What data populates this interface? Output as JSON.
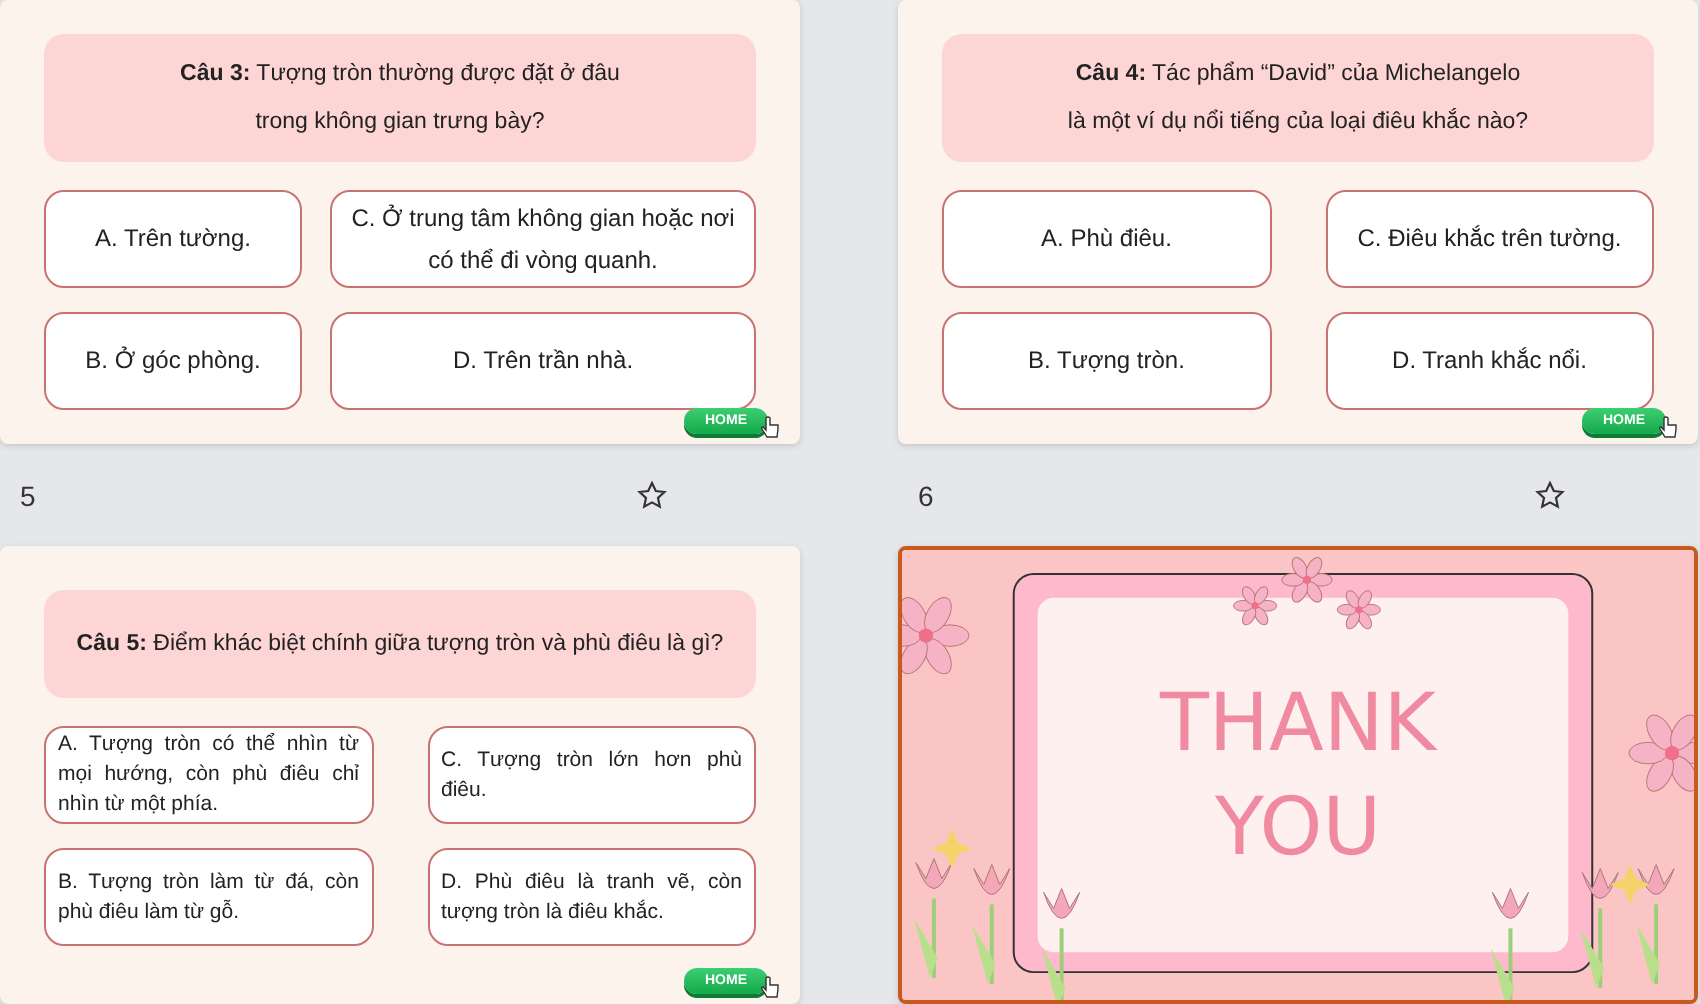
{
  "slides": [
    {
      "kind": "quiz",
      "selected": false,
      "number": "5",
      "question_lines": [
        "**Câu 3:** Tượng tròn thường được đặt ở đâu",
        "trong không gian trưng bày?"
      ],
      "options": [
        "A. Trên tường.",
        "B. Ở góc phòng.",
        "C. Ở trung tâm không gian hoặc nơi có thể đi vòng quanh.",
        "D. Trên trần nhà."
      ],
      "home": "HOME"
    },
    {
      "kind": "quiz",
      "selected": false,
      "number": "6",
      "question_lines": [
        "**Câu 4:** Tác phẩm “David” của Michelangelo",
        "là một ví dụ nổi tiếng của loại điêu khắc nào?"
      ],
      "options": [
        "A. Phù điêu.",
        "B. Tượng tròn.",
        "C. Điêu khắc trên tường.",
        "D. Tranh khắc nổi."
      ],
      "home": "HOME"
    },
    {
      "kind": "quiz",
      "selected": false,
      "question_lines": [
        "**Câu 5:** Điểm khác biệt chính giữa tượng tròn và phù điêu là gì?"
      ],
      "options": [
        "A. Tượng tròn có thể nhìn từ mọi hướng, còn phù điêu chỉ nhìn từ một phía.",
        "B. Tượng tròn làm từ đá, còn phù điêu làm từ gỗ.",
        "C. Tượng tròn lớn hơn phù điêu.",
        "D. Phù điêu là tranh vẽ, còn tượng tròn là điêu khắc."
      ],
      "home": "HOME"
    },
    {
      "kind": "thanks",
      "selected": true,
      "lines": [
        "THANK",
        "YOU"
      ]
    }
  ]
}
